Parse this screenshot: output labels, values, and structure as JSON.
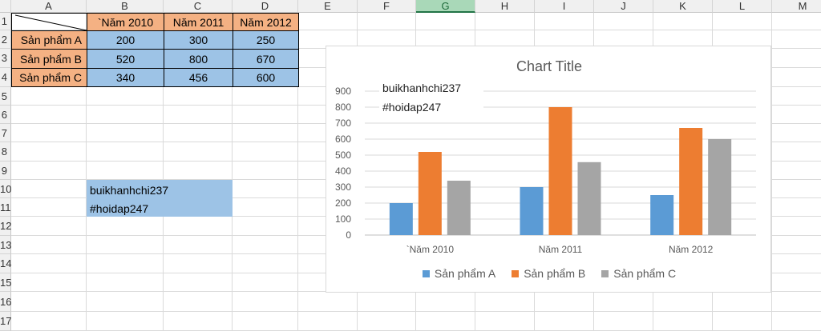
{
  "columns": [
    "A",
    "B",
    "C",
    "D",
    "E",
    "F",
    "G",
    "H",
    "I",
    "J",
    "K",
    "L",
    "M"
  ],
  "selected_column": "G",
  "rows": [
    "1",
    "2",
    "3",
    "4",
    "5",
    "6",
    "7",
    "8",
    "9",
    "10",
    "11",
    "12",
    "13",
    "14",
    "15",
    "16",
    "17"
  ],
  "table": {
    "headers": [
      "`Năm 2010",
      "Năm 2011",
      "Năm 2012"
    ],
    "rows": [
      {
        "label": "Sản phẩm A",
        "values": [
          "200",
          "300",
          "250"
        ]
      },
      {
        "label": "Sản phẩm B",
        "values": [
          "520",
          "800",
          "670"
        ]
      },
      {
        "label": "Sản phẩm C",
        "values": [
          "340",
          "456",
          "600"
        ]
      }
    ]
  },
  "sheet_textbox": {
    "line1": "buikhanhchi237",
    "line2": "#hoidap247"
  },
  "chart_note": {
    "line1": "buikhanhchi237",
    "line2": "#hoidap247"
  },
  "colors": {
    "series_a": "#5b9bd5",
    "series_b": "#ed7d31",
    "series_c": "#a5a5a5",
    "header_fill": "#f4b183",
    "data_fill": "#9dc3e6"
  },
  "chart_data": {
    "type": "bar",
    "title": "Chart Title",
    "categories": [
      "`Năm 2010",
      "Năm 2011",
      "Năm 2012"
    ],
    "series": [
      {
        "name": "Sản phẩm A",
        "values": [
          200,
          300,
          250
        ]
      },
      {
        "name": "Sản phẩm B",
        "values": [
          520,
          800,
          670
        ]
      },
      {
        "name": "Sản phẩm C",
        "values": [
          340,
          456,
          600
        ]
      }
    ],
    "yticks": [
      "0",
      "100",
      "200",
      "300",
      "400",
      "500",
      "600",
      "700",
      "800",
      "900"
    ],
    "ylim": [
      0,
      900
    ],
    "grid": true,
    "legend": "bottom"
  }
}
